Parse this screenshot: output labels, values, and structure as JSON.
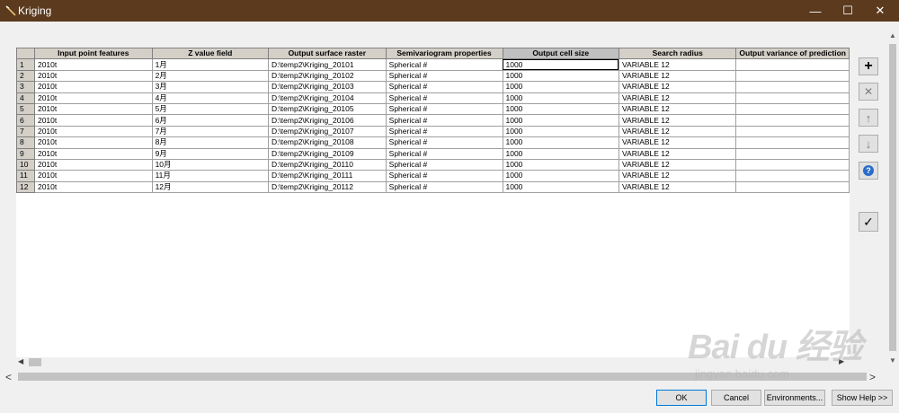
{
  "window": {
    "title": "Kriging",
    "minimize_glyph": "—",
    "maximize_glyph": "☐",
    "close_glyph": "✕"
  },
  "grid": {
    "columns": [
      "Input point features",
      "Z value field",
      "Output surface raster",
      "Semivariogram properties",
      "Output cell size",
      "Search radius",
      "Output variance of prediction"
    ],
    "rows": [
      {
        "num": "1",
        "input": "2010t",
        "z": "1月",
        "output": "D:\\temp2\\Kriging_20101",
        "semi": "Spherical #",
        "cell": "1000",
        "radius": "VARIABLE 12",
        "variance": ""
      },
      {
        "num": "2",
        "input": "2010t",
        "z": "2月",
        "output": "D:\\temp2\\Kriging_20102",
        "semi": "Spherical #",
        "cell": "1000",
        "radius": "VARIABLE 12",
        "variance": ""
      },
      {
        "num": "3",
        "input": "2010t",
        "z": "3月",
        "output": "D:\\temp2\\Kriging_20103",
        "semi": "Spherical #",
        "cell": "1000",
        "radius": "VARIABLE 12",
        "variance": ""
      },
      {
        "num": "4",
        "input": "2010t",
        "z": "4月",
        "output": "D:\\temp2\\Kriging_20104",
        "semi": "Spherical #",
        "cell": "1000",
        "radius": "VARIABLE 12",
        "variance": ""
      },
      {
        "num": "5",
        "input": "2010t",
        "z": "5月",
        "output": "D:\\temp2\\Kriging_20105",
        "semi": "Spherical #",
        "cell": "1000",
        "radius": "VARIABLE 12",
        "variance": ""
      },
      {
        "num": "6",
        "input": "2010t",
        "z": "6月",
        "output": "D:\\temp2\\Kriging_20106",
        "semi": "Spherical #",
        "cell": "1000",
        "radius": "VARIABLE 12",
        "variance": ""
      },
      {
        "num": "7",
        "input": "2010t",
        "z": "7月",
        "output": "D:\\temp2\\Kriging_20107",
        "semi": "Spherical #",
        "cell": "1000",
        "radius": "VARIABLE 12",
        "variance": ""
      },
      {
        "num": "8",
        "input": "2010t",
        "z": "8月",
        "output": "D:\\temp2\\Kriging_20108",
        "semi": "Spherical #",
        "cell": "1000",
        "radius": "VARIABLE 12",
        "variance": ""
      },
      {
        "num": "9",
        "input": "2010t",
        "z": "9月",
        "output": "D:\\temp2\\Kriging_20109",
        "semi": "Spherical #",
        "cell": "1000",
        "radius": "VARIABLE 12",
        "variance": ""
      },
      {
        "num": "10",
        "input": "2010t",
        "z": "10月",
        "output": "D:\\temp2\\Kriging_20110",
        "semi": "Spherical #",
        "cell": "1000",
        "radius": "VARIABLE 12",
        "variance": ""
      },
      {
        "num": "11",
        "input": "2010t",
        "z": "11月",
        "output": "D:\\temp2\\Kriging_20111",
        "semi": "Spherical #",
        "cell": "1000",
        "radius": "VARIABLE 12",
        "variance": ""
      },
      {
        "num": "12",
        "input": "2010t",
        "z": "12月",
        "output": "D:\\temp2\\Kriging_20112",
        "semi": "Spherical #",
        "cell": "1000",
        "radius": "VARIABLE 12",
        "variance": ""
      }
    ]
  },
  "side_buttons": {
    "add": "+",
    "remove": "✕",
    "up": "↑",
    "down": "↓",
    "help": "?",
    "check": "✓"
  },
  "bottom_buttons": {
    "ok": "OK",
    "cancel": "Cancel",
    "environments": "Environments...",
    "show_help": "Show Help >>"
  },
  "watermark": {
    "brand": "Bai du 经验",
    "url": "jingyan.baidu.com"
  },
  "colors": {
    "titlebar": "#5b3a1e",
    "header": "#d4d0c8",
    "ok_border": "#0078d7"
  }
}
